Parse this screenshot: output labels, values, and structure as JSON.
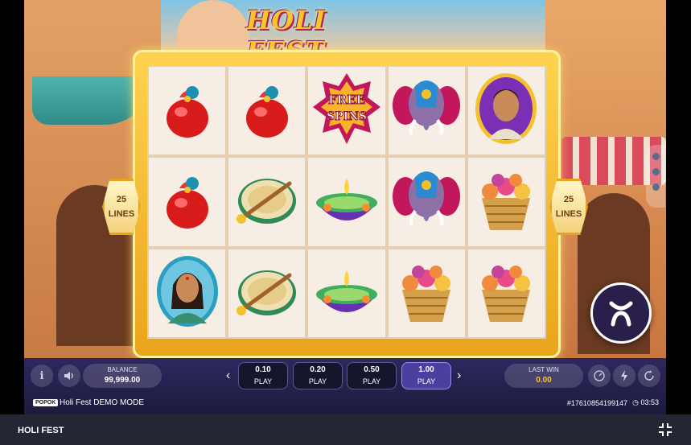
{
  "game": {
    "logo_text": "HOLI FEST",
    "lines_left": {
      "count": "25",
      "label": "LINES"
    },
    "lines_right": {
      "count": "25",
      "label": "LINES"
    },
    "reels": [
      [
        "red-gulal-pouch",
        "red-gulal-pouch",
        "free-spins",
        "decorated-elephant",
        "man-portrait"
      ],
      [
        "red-gulal-pouch",
        "dholak-drum",
        "diya-lamp",
        "decorated-elephant",
        "flower-basket"
      ],
      [
        "woman-portrait",
        "dholak-drum",
        "diya-lamp",
        "flower-basket",
        "flower-basket"
      ]
    ],
    "free_spins_text": [
      "FREE",
      "SPINS"
    ]
  },
  "controls": {
    "balance_label": "BALANCE",
    "balance_value": "99,999.00",
    "bets": [
      {
        "amount": "0.10",
        "label": "PLAY",
        "active": false
      },
      {
        "amount": "0.20",
        "label": "PLAY",
        "active": false
      },
      {
        "amount": "0.50",
        "label": "PLAY",
        "active": false
      },
      {
        "amount": "1.00",
        "label": "PLAY",
        "active": true
      }
    ],
    "last_win_label": "LAST WIN",
    "last_win_value": "0.00",
    "info_icon": "info-icon",
    "sound_icon": "sound-icon"
  },
  "footer": {
    "brand": "POPOK",
    "mode_text": "Holi Fest DEMO MODE",
    "round_id": "#17610854199147",
    "time": "03:53"
  },
  "titlebar": {
    "title": "HOLI FEST"
  },
  "colors": {
    "frame_gold": "#f3c12e",
    "bar_bg": "#2e2860",
    "active_bet": "#4b3fa0",
    "win_gold": "#f3c53a"
  }
}
